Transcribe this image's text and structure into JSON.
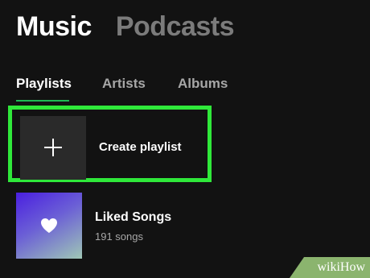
{
  "top_tabs": {
    "music": "Music",
    "podcasts": "Podcasts"
  },
  "sub_tabs": {
    "playlists": "Playlists",
    "artists": "Artists",
    "albums": "Albums"
  },
  "create_playlist": {
    "label": "Create playlist",
    "icon": "plus-icon"
  },
  "liked_songs": {
    "title": "Liked Songs",
    "subtitle": "191 songs",
    "icon": "heart-icon"
  },
  "watermark": {
    "text": "wikiHow"
  },
  "colors": {
    "background": "#121212",
    "accent": "#1db954",
    "highlight_border": "#2fe83a",
    "watermark_bg": "#8bb46e"
  }
}
